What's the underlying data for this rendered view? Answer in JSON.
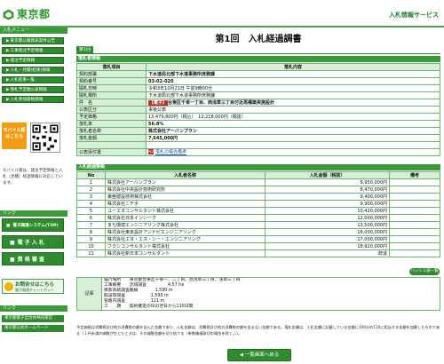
{
  "header": {
    "logo_text": "東京都",
    "service": "入札情報サービス",
    "colors": {
      "green": "#2e8b2e",
      "light_green": "#d7efd7",
      "red": "#c62828",
      "orange": "#f39c12"
    }
  },
  "sidebar": {
    "section_menu": "入札メニュー",
    "menu_items": [
      "東京都公報発表案件公告",
      "工事発注予定情報",
      "発注予定情報",
      "入札・見積(結果)情報",
      "入札結果一覧",
      "落札予定額公表情報",
      "入札参加資格情報"
    ],
    "mobile_badge": "モバイル版\nはこちら",
    "mobile_note": "モバイル版は、発注予定情報と入札（見積）経過情報に対応しています。",
    "section_links": "リンク",
    "big_buttons": [
      "電子調達システム(TOP)",
      "電 子 入 札",
      "資 格 審 査"
    ],
    "ask_title": "お問合せはこちら",
    "ask_sub": "電子調達チャットボット",
    "section_bottom": "リンク",
    "bottom_links": [
      "東京都電子自治体共同運営",
      "東京都公式ホームページ"
    ]
  },
  "main": {
    "title": "第1回　入札経過調書",
    "sub_pill": "第1回",
    "section1": "落札者情報",
    "table1_head": [
      "落札項目",
      "落札内容"
    ],
    "table1": [
      {
        "k": "契約部署",
        "v": "下水道局北部下水道事務所庶務課",
        "bold": true
      },
      {
        "k": "契約番号",
        "v": "03-02-020",
        "bold": true
      },
      {
        "k": "開札日時",
        "v": "令和3年10月21日 午前9時00分",
        "bold": false
      },
      {
        "k": "開札場所",
        "v": "下水道局北部下水道事務所庶務課",
        "bold": false
      },
      {
        "k": "件　名",
        "tag": "【電子】",
        "v": "台東区千束一丁目、西浅草三丁目付近再構築実施設計",
        "bold": true
      },
      {
        "k": "公表区分",
        "v": "事後公表",
        "bold": false
      },
      {
        "k": "予定価格",
        "v": "13,479,800円（税込）　12,218,000円（税抜）",
        "bold": false
      },
      {
        "k": "落札率",
        "v": "56.8%",
        "bold": true
      },
      {
        "k": "落札者名称",
        "v": "株式会社アーバンプラン",
        "bold": true
      },
      {
        "k": "落札金額",
        "v": "7,645,000円",
        "bold": true
      },
      {
        "k": "",
        "v": "",
        "bold": false
      },
      {
        "k": "公表添付書",
        "pdf": "PDF",
        "v": "落札の場合備考",
        "bold": false
      }
    ],
    "section2": "入札経過情報",
    "table2_head": [
      "No",
      "入札者名称",
      "入札金額（税抜）",
      "備考"
    ],
    "table2": [
      {
        "no": "1",
        "name": "株式会社アーバンプラン",
        "amt": "6,950,000円",
        "note": ""
      },
      {
        "no": "2",
        "name": "株式会社中央設計技術研究所",
        "amt": "8,470,000円",
        "note": ""
      },
      {
        "no": "3",
        "name": "東亜建設技術株式会社",
        "amt": "9,400,000円",
        "note": ""
      },
      {
        "no": "4",
        "name": "株式会社ニチボ",
        "amt": "9,900,000円",
        "note": ""
      },
      {
        "no": "5",
        "name": "ユーエヌコンサルタント株式会社",
        "amt": "10,420,000円",
        "note": ""
      },
      {
        "no": "6",
        "name": "株式会社日本インシーク",
        "amt": "12,000,000円",
        "note": ""
      },
      {
        "no": "7",
        "name": "まち環境エンジニアリング株式会社",
        "amt": "13,500,000円",
        "note": ""
      },
      {
        "no": "8",
        "name": "株式会社東京設計アンドビエンジニアリング",
        "amt": "16,000,000円",
        "note": ""
      },
      {
        "no": "9",
        "name": "株式会社エヌ・エス・シー・エンジニアリング",
        "amt": "17,000,000円",
        "note": ""
      },
      {
        "no": "10",
        "name": "フクシコンサルタント株式会社",
        "amt": "18,920,000円",
        "note": ""
      },
      {
        "no": "11",
        "name": "株式会社新日本コンサルタント",
        "amt": "辞退",
        "note": ""
      }
    ],
    "memo_btn": "ハッシュ値一覧",
    "remarks_label": "記事",
    "remarks": [
      "履行場所　　東京都台東区千束一、二丁目、西浅草三丁目、浅草三丁目",
      "工事概要　　流域調査　　　　　4.57 ha",
      "摸索系統調査路線　　　　1,590 m",
      "既設管調査　　　　　　1,590 m",
      "管路内調査　　　　　　121 m",
      "工　　期　　契約確定の日の翌日から110日間"
    ],
    "note": "予定価格は消費税及び地方消費税の額を含んだ金額であり、入札金額は、消費税及び地方消費税の額を含まない金額である。落札金額は、入札金額に記載している金額に100分の110に相当する金額を加算したものである（１円未満の端数が生じたときは、その端数金額を切り捨てる（単数端値取切の場合を除く。））。",
    "back_btn": "◀ 一覧画面へ戻る"
  }
}
